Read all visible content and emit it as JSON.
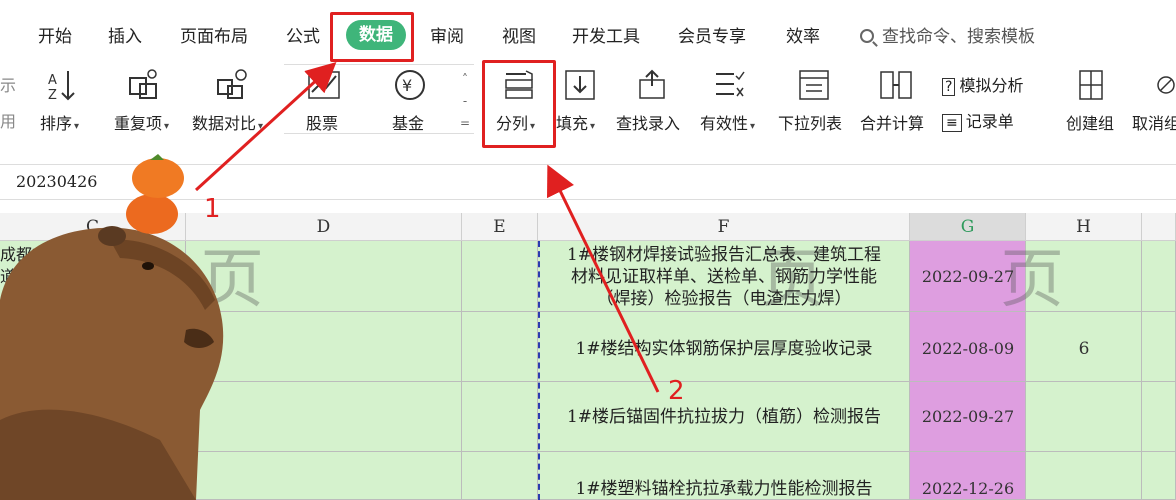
{
  "menu": {
    "items": [
      "开始",
      "插入",
      "页面布局",
      "公式",
      "审阅",
      "视图",
      "开发工具",
      "会员专享",
      "效率"
    ],
    "active": "数据",
    "search_placeholder": "查找命令、搜索模板"
  },
  "ribbon": {
    "side_labels": [
      "示",
      "用"
    ],
    "buttons": [
      {
        "label": "排序",
        "dropdown": true
      },
      {
        "label": "重复项",
        "dropdown": true
      },
      {
        "label": "数据对比",
        "dropdown": true
      },
      {
        "label": "股票",
        "dropdown": false
      },
      {
        "label": "基金",
        "dropdown": false
      },
      {
        "label": "分列",
        "dropdown": true
      },
      {
        "label": "填充",
        "dropdown": true
      },
      {
        "label": "查找录入",
        "dropdown": false
      },
      {
        "label": "有效性",
        "dropdown": true
      },
      {
        "label": "下拉列表",
        "dropdown": false
      },
      {
        "label": "合并计算",
        "dropdown": false
      },
      {
        "label": "创建组",
        "dropdown": false
      },
      {
        "label": "取消组",
        "dropdown": false
      }
    ],
    "small_buttons": [
      "模拟分析",
      "记录单"
    ]
  },
  "formula_bar": {
    "value": "20230426"
  },
  "sheet": {
    "columns": [
      "C",
      "D",
      "E",
      "F",
      "G",
      "H"
    ],
    "selected_column": "G",
    "rows": [
      {
        "c": "成都市成\n道",
        "f": "1#楼钢材焊接试验报告汇总表、建筑工程\n材料见证取样单、送检单、钢筋力学性能\n（焊接）检验报告（电渣压力焊）",
        "g": "2022-09-27",
        "h": ""
      },
      {
        "c": "",
        "f": "1#楼结构实体钢筋保护层厚度验收记录",
        "g": "2022-08-09",
        "h": "6"
      },
      {
        "c": "",
        "f": "1#楼后锚固件抗拉拔力（植筋）检测报告",
        "g": "2022-09-27",
        "h": ""
      },
      {
        "c": "",
        "f": "1#楼塑料锚栓抗拉承载力性能检测报告",
        "g": "2022-12-26",
        "h": ""
      }
    ],
    "watermark": [
      "页",
      "页",
      "页"
    ]
  },
  "annotations": {
    "labels": [
      "1",
      "2"
    ],
    "color": "#e02020"
  },
  "colors": {
    "accent": "#3fb57a",
    "cell_green": "#d5f2cd",
    "cell_pink": "#de9ee0"
  }
}
